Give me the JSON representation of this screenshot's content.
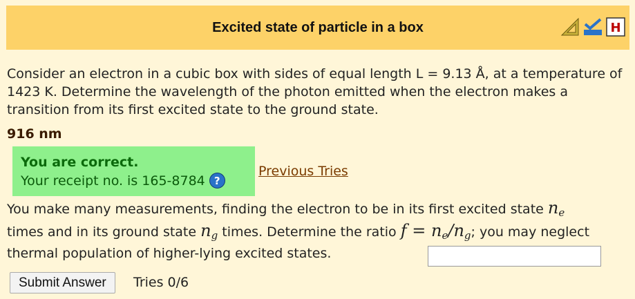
{
  "header": {
    "title": "Excited state of particle in a box",
    "icons": [
      "triangle-ruler-icon",
      "checkmark-feedback-icon",
      "hint-icon"
    ],
    "icon_letter": "H"
  },
  "question1": {
    "text": "Consider an electron in a cubic box with sides of equal length L = 9.13 Å, at a temperature of 1423 K. Determine the wavelength of the photon emitted when the electron makes a transition from its first excited state to the ground state.",
    "answer": "916 nm"
  },
  "feedback": {
    "status": "You are correct.",
    "receipt": "Your receipt no. is 165-8784",
    "help_icon": "?",
    "previous_tries": "Previous Tries"
  },
  "question2": {
    "part1": "You make many measurements, finding the electron to be in its first excited state",
    "part2": "times and in its ground state",
    "part3": "times. Determine the ratio",
    "part4": "; you may neglect thermal population of higher-lying excited states.",
    "math_n": "n",
    "sub_e": "e",
    "sub_g": "g",
    "math_f": "f",
    "math_eq": " = ",
    "math_slash": "/"
  },
  "answer_input": {
    "value": "",
    "placeholder": ""
  },
  "submit": {
    "label": "Submit Answer"
  },
  "tries": "Tries 0/6",
  "colors": {
    "header_bg": "#fdd268",
    "page_bg": "#fff6d8",
    "correct_bg": "#8ef08c",
    "link": "#7a3b00"
  }
}
